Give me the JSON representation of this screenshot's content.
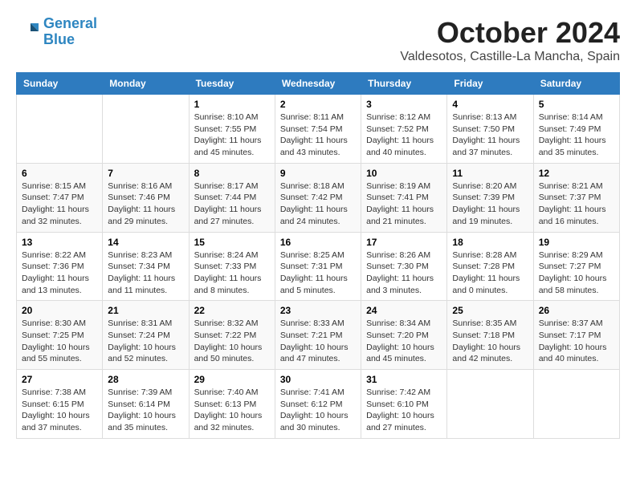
{
  "header": {
    "logo_line1": "General",
    "logo_line2": "Blue",
    "month": "October 2024",
    "location": "Valdesotos, Castille-La Mancha, Spain"
  },
  "weekdays": [
    "Sunday",
    "Monday",
    "Tuesday",
    "Wednesday",
    "Thursday",
    "Friday",
    "Saturday"
  ],
  "weeks": [
    [
      {
        "day": "",
        "info": ""
      },
      {
        "day": "",
        "info": ""
      },
      {
        "day": "1",
        "info": "Sunrise: 8:10 AM\nSunset: 7:55 PM\nDaylight: 11 hours and 45 minutes."
      },
      {
        "day": "2",
        "info": "Sunrise: 8:11 AM\nSunset: 7:54 PM\nDaylight: 11 hours and 43 minutes."
      },
      {
        "day": "3",
        "info": "Sunrise: 8:12 AM\nSunset: 7:52 PM\nDaylight: 11 hours and 40 minutes."
      },
      {
        "day": "4",
        "info": "Sunrise: 8:13 AM\nSunset: 7:50 PM\nDaylight: 11 hours and 37 minutes."
      },
      {
        "day": "5",
        "info": "Sunrise: 8:14 AM\nSunset: 7:49 PM\nDaylight: 11 hours and 35 minutes."
      }
    ],
    [
      {
        "day": "6",
        "info": "Sunrise: 8:15 AM\nSunset: 7:47 PM\nDaylight: 11 hours and 32 minutes."
      },
      {
        "day": "7",
        "info": "Sunrise: 8:16 AM\nSunset: 7:46 PM\nDaylight: 11 hours and 29 minutes."
      },
      {
        "day": "8",
        "info": "Sunrise: 8:17 AM\nSunset: 7:44 PM\nDaylight: 11 hours and 27 minutes."
      },
      {
        "day": "9",
        "info": "Sunrise: 8:18 AM\nSunset: 7:42 PM\nDaylight: 11 hours and 24 minutes."
      },
      {
        "day": "10",
        "info": "Sunrise: 8:19 AM\nSunset: 7:41 PM\nDaylight: 11 hours and 21 minutes."
      },
      {
        "day": "11",
        "info": "Sunrise: 8:20 AM\nSunset: 7:39 PM\nDaylight: 11 hours and 19 minutes."
      },
      {
        "day": "12",
        "info": "Sunrise: 8:21 AM\nSunset: 7:37 PM\nDaylight: 11 hours and 16 minutes."
      }
    ],
    [
      {
        "day": "13",
        "info": "Sunrise: 8:22 AM\nSunset: 7:36 PM\nDaylight: 11 hours and 13 minutes."
      },
      {
        "day": "14",
        "info": "Sunrise: 8:23 AM\nSunset: 7:34 PM\nDaylight: 11 hours and 11 minutes."
      },
      {
        "day": "15",
        "info": "Sunrise: 8:24 AM\nSunset: 7:33 PM\nDaylight: 11 hours and 8 minutes."
      },
      {
        "day": "16",
        "info": "Sunrise: 8:25 AM\nSunset: 7:31 PM\nDaylight: 11 hours and 5 minutes."
      },
      {
        "day": "17",
        "info": "Sunrise: 8:26 AM\nSunset: 7:30 PM\nDaylight: 11 hours and 3 minutes."
      },
      {
        "day": "18",
        "info": "Sunrise: 8:28 AM\nSunset: 7:28 PM\nDaylight: 11 hours and 0 minutes."
      },
      {
        "day": "19",
        "info": "Sunrise: 8:29 AM\nSunset: 7:27 PM\nDaylight: 10 hours and 58 minutes."
      }
    ],
    [
      {
        "day": "20",
        "info": "Sunrise: 8:30 AM\nSunset: 7:25 PM\nDaylight: 10 hours and 55 minutes."
      },
      {
        "day": "21",
        "info": "Sunrise: 8:31 AM\nSunset: 7:24 PM\nDaylight: 10 hours and 52 minutes."
      },
      {
        "day": "22",
        "info": "Sunrise: 8:32 AM\nSunset: 7:22 PM\nDaylight: 10 hours and 50 minutes."
      },
      {
        "day": "23",
        "info": "Sunrise: 8:33 AM\nSunset: 7:21 PM\nDaylight: 10 hours and 47 minutes."
      },
      {
        "day": "24",
        "info": "Sunrise: 8:34 AM\nSunset: 7:20 PM\nDaylight: 10 hours and 45 minutes."
      },
      {
        "day": "25",
        "info": "Sunrise: 8:35 AM\nSunset: 7:18 PM\nDaylight: 10 hours and 42 minutes."
      },
      {
        "day": "26",
        "info": "Sunrise: 8:37 AM\nSunset: 7:17 PM\nDaylight: 10 hours and 40 minutes."
      }
    ],
    [
      {
        "day": "27",
        "info": "Sunrise: 7:38 AM\nSunset: 6:15 PM\nDaylight: 10 hours and 37 minutes."
      },
      {
        "day": "28",
        "info": "Sunrise: 7:39 AM\nSunset: 6:14 PM\nDaylight: 10 hours and 35 minutes."
      },
      {
        "day": "29",
        "info": "Sunrise: 7:40 AM\nSunset: 6:13 PM\nDaylight: 10 hours and 32 minutes."
      },
      {
        "day": "30",
        "info": "Sunrise: 7:41 AM\nSunset: 6:12 PM\nDaylight: 10 hours and 30 minutes."
      },
      {
        "day": "31",
        "info": "Sunrise: 7:42 AM\nSunset: 6:10 PM\nDaylight: 10 hours and 27 minutes."
      },
      {
        "day": "",
        "info": ""
      },
      {
        "day": "",
        "info": ""
      }
    ]
  ]
}
